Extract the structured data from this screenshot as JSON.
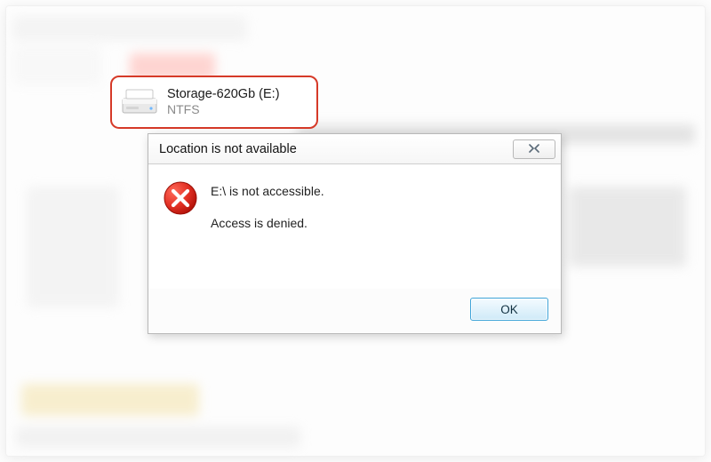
{
  "drive": {
    "name": "Storage-620Gb (E:)",
    "filesystem": "NTFS"
  },
  "dialog": {
    "title": "Location is not available",
    "line1": "E:\\ is not accessible.",
    "line2": "Access is denied.",
    "ok_label": "OK"
  }
}
